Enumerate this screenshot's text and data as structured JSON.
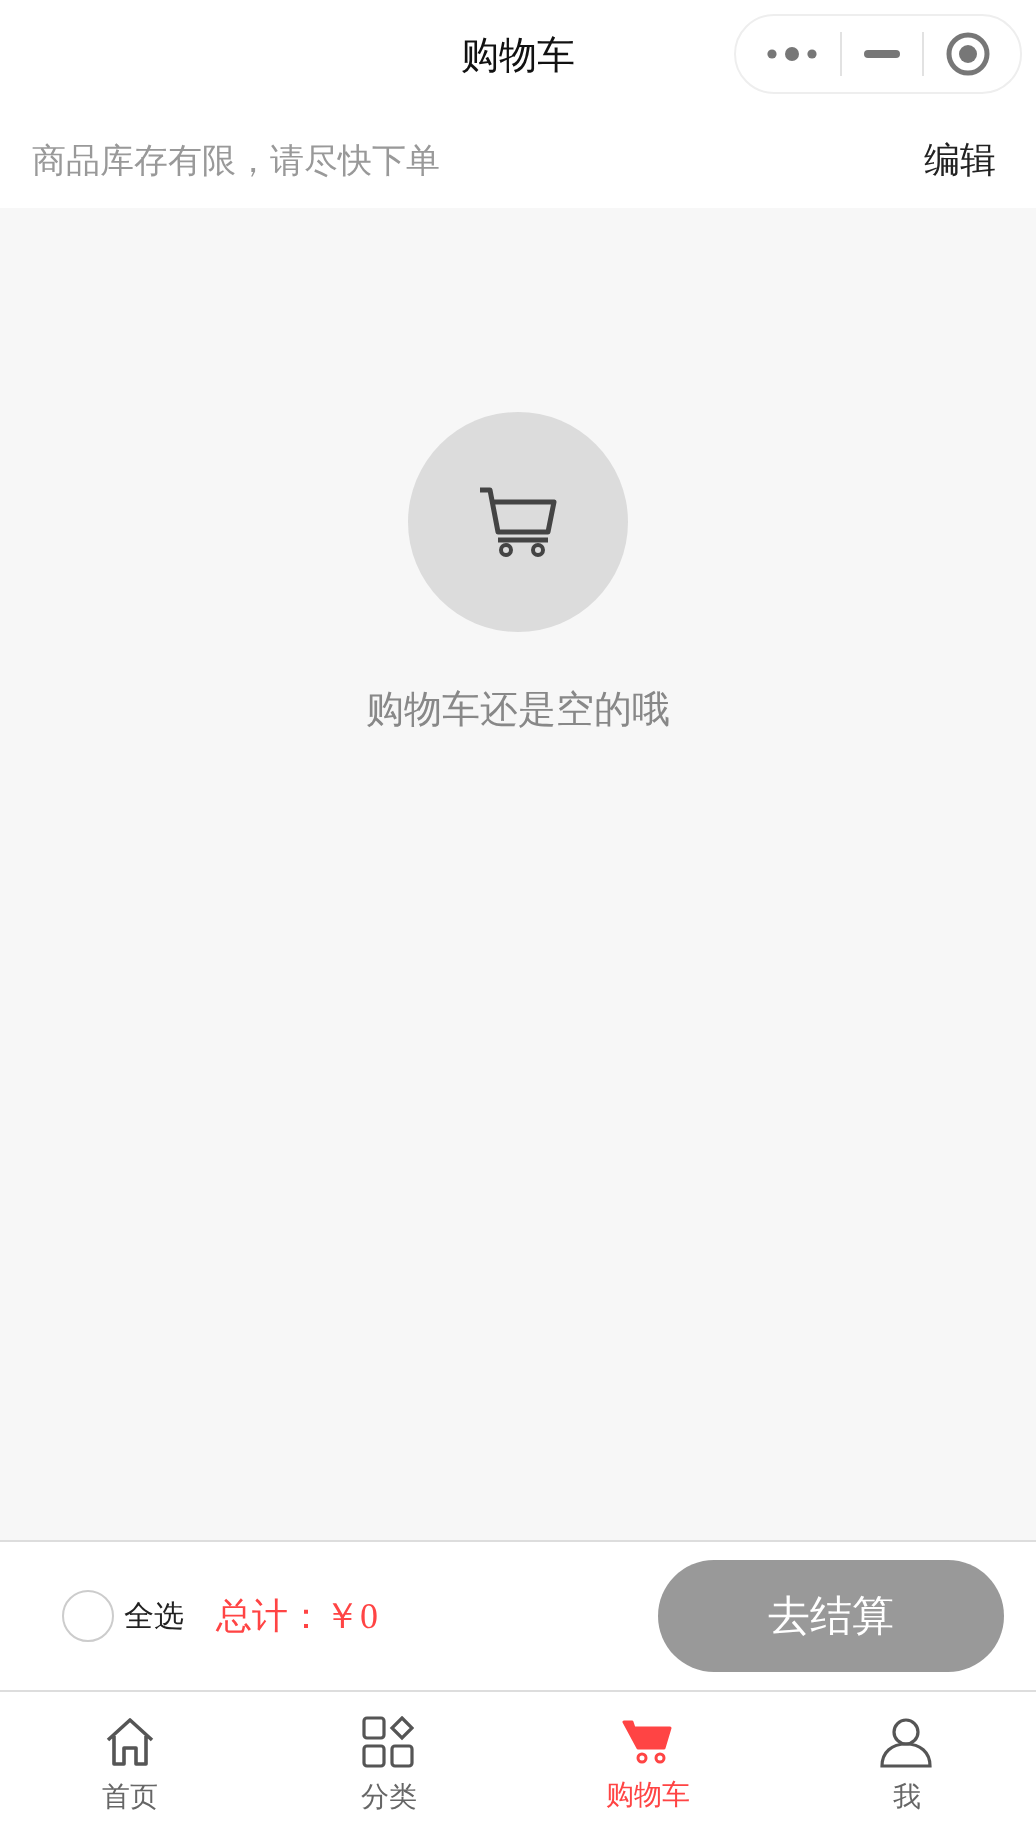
{
  "nav_bar": {
    "title": "购物车"
  },
  "notice": {
    "text": "商品库存有限，请尽快下单",
    "action": "编辑"
  },
  "empty_state": {
    "message": "购物车还是空的哦"
  },
  "checkout_bar": {
    "select_all": {
      "label": "全选",
      "checked": false
    },
    "total_label": "总计：",
    "total_amount": "￥0",
    "button": "去结算"
  },
  "tab_bar": [
    {
      "kind": "home",
      "label": "首页",
      "selected": false
    },
    {
      "kind": "category",
      "label": "分类",
      "selected": false
    },
    {
      "kind": "cart",
      "label": "购物车",
      "selected": true
    },
    {
      "kind": "profile",
      "label": "我",
      "selected": false
    }
  ]
}
